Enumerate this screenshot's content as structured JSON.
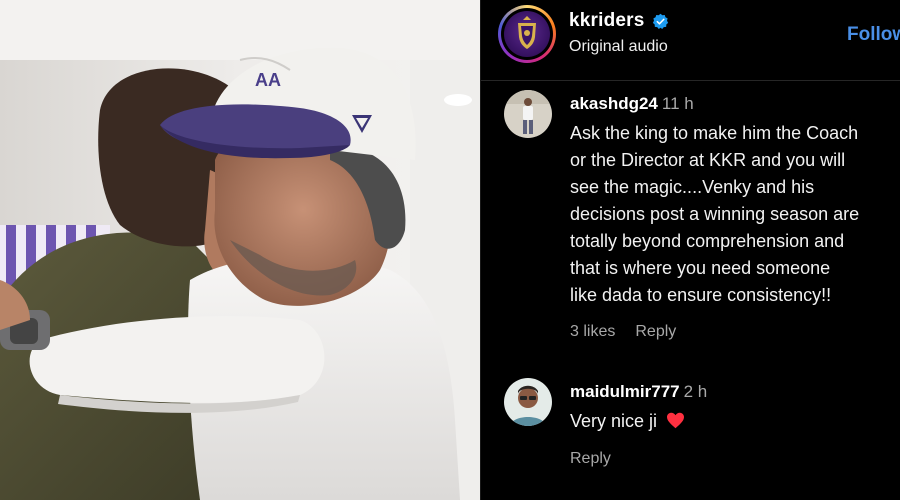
{
  "post": {
    "username": "kkriders",
    "audio_label": "Original audio",
    "follow_label": "Follow"
  },
  "comments": [
    {
      "username": "akashdg24",
      "time": "11 h",
      "text_lines": [
        "Ask the king to make him the Coach",
        "or the Director at KKR and you will",
        "see the magic....Venky and his",
        "decisions post a winning season are",
        "totally beyond comprehension and",
        "that is where you need someone",
        "like dada to ensure consistency!!"
      ],
      "likes": "3 likes",
      "reply_label": "Reply"
    },
    {
      "username": "maidulmir777",
      "time": "2 h",
      "text": "Very nice ji",
      "reply_label": "Reply"
    }
  ],
  "colors": {
    "background": "#000000",
    "link_blue": "#4a8fe7",
    "verified_blue": "#1d9bf0",
    "heart_red": "#ff3040",
    "secondary_text": "#a8a8a8"
  },
  "icons": [
    "verified-badge-icon",
    "heart-icon"
  ]
}
